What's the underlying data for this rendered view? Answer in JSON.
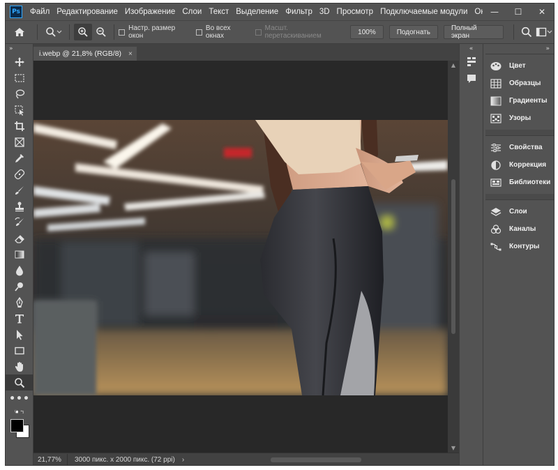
{
  "app": {
    "logo": "Ps",
    "menu": [
      "Файл",
      "Редактирование",
      "Изображение",
      "Слои",
      "Текст",
      "Выделение",
      "Фильтр",
      "3D",
      "Просмотр",
      "Подключаемые модули",
      "Окно"
    ],
    "window_controls": {
      "minimize": "—",
      "maximize": "☐",
      "close": "✕"
    }
  },
  "options": {
    "checkbox_resize": "Настр. размер окон",
    "checkbox_all_windows": "Во всех окнах",
    "checkbox_scrubby": "Масшт. перетаскиванием",
    "zoom_value": "100%",
    "fit_button": "Подогнать",
    "fullscreen_button": "Полный экран"
  },
  "document": {
    "tab_title": "i.webp @ 21,8% (RGB/8)",
    "tab_close": "×"
  },
  "status": {
    "zoom": "21,77%",
    "info": "3000 пикс. x 2000 пикс. (72 ppi)",
    "arrow": "›"
  },
  "panels": {
    "group1": [
      "Цвет",
      "Образцы",
      "Градиенты",
      "Узоры"
    ],
    "group2": [
      "Свойства",
      "Коррекция",
      "Библиотеки"
    ],
    "group3": [
      "Слои",
      "Каналы",
      "Контуры"
    ]
  },
  "colors": {
    "ui_bg": "#535353",
    "canvas_bg": "#282828",
    "foreground_swatch": "#000000",
    "background_swatch": "#ffffff",
    "accent": "#31a8ff"
  }
}
